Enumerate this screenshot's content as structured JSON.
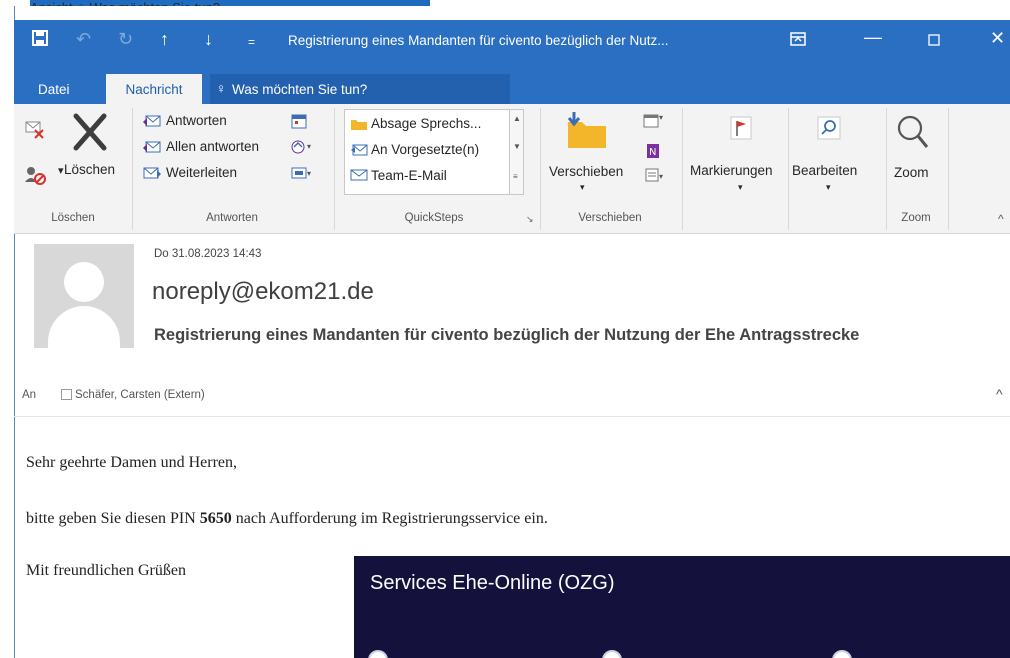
{
  "background_window": {
    "tab_view": "Ansicht",
    "tell_me": "Was möchten Sie tun?"
  },
  "titlebar": {
    "title": "Registrierung eines Mandanten für civento bezüglich der Nutz...",
    "icons": [
      "save-icon",
      "undo-icon",
      "redo-icon",
      "arrow-up-icon",
      "arrow-down-icon",
      "customize-icon",
      "ribbon-display-icon",
      "minimize-icon",
      "maximize-icon",
      "close-icon"
    ]
  },
  "tabs": {
    "file": "Datei",
    "message": "Nachricht",
    "tell_me": "Was möchten Sie tun?"
  },
  "ribbon": {
    "delete_group": {
      "label": "Löschen",
      "delete_button": "Löschen"
    },
    "respond_group": {
      "label": "Antworten",
      "reply": "Antworten",
      "reply_all": "Allen antworten",
      "forward": "Weiterleiten"
    },
    "quicksteps_group": {
      "label": "QuickSteps",
      "items": [
        "Absage Sprechs...",
        "An Vorgesetzte(n)",
        "Team-E-Mail"
      ]
    },
    "move_group": {
      "label": "Verschieben",
      "move_button": "Verschieben"
    },
    "tags": {
      "flags_button": "Markierungen"
    },
    "editing": {
      "edit_button": "Bearbeiten"
    },
    "zoom_group": {
      "label": "Zoom",
      "zoom_button": "Zoom"
    }
  },
  "message": {
    "date": "Do 31.08.2023 14:43",
    "from": "noreply@ekom21.de",
    "subject": "Registrierung eines Mandanten für civento bezüglich der Nutzung der Ehe Antragsstrecke",
    "to_label": "An",
    "to_name": "Schäfer, Carsten (Extern)"
  },
  "body": {
    "greeting": "Sehr geehrte Damen und Herren,",
    "line_pre": "bitte geben Sie diesen PIN ",
    "pin": "5650",
    "line_post": " nach Aufforderung im Registrierungsservice ein.",
    "closing": "Mit freundlichen Grüßen"
  },
  "banner": {
    "title": "Services Ehe-Online (OZG)"
  },
  "colors": {
    "titlebar_blue": "#2b6fc2",
    "ribbon_gray": "#f3f3f3",
    "banner_navy": "#14123d",
    "flag_red": "#d9322c"
  }
}
